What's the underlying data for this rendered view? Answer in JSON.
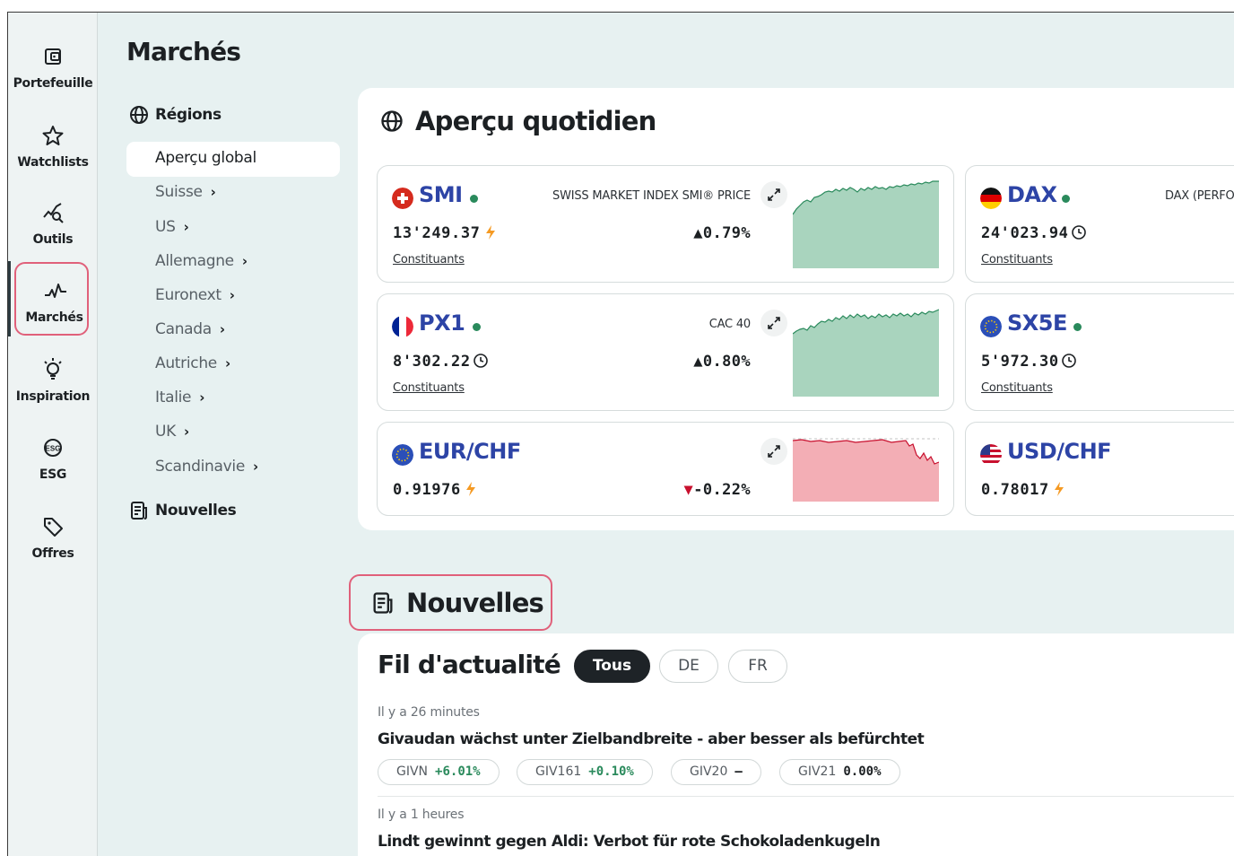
{
  "rail": [
    {
      "label": "Portefeuille",
      "icon": "wallet-icon"
    },
    {
      "label": "Watchlists",
      "icon": "star-icon"
    },
    {
      "label": "Outils",
      "icon": "chart-search-icon"
    },
    {
      "label": "Marchés",
      "icon": "pulse-icon",
      "active": true
    },
    {
      "label": "Inspiration",
      "icon": "lightbulb-icon"
    },
    {
      "label": "ESG",
      "icon": "esg-leaf-icon"
    },
    {
      "label": "Offres",
      "icon": "tag-icon"
    }
  ],
  "page_title": "Marchés",
  "nav": {
    "regions_label": "Régions",
    "items": [
      {
        "label": "Aperçu global",
        "selected": true,
        "chevron": ""
      },
      {
        "label": "Suisse",
        "chevron": "›"
      },
      {
        "label": "US",
        "chevron": "›"
      },
      {
        "label": "Allemagne",
        "chevron": "›"
      },
      {
        "label": "Euronext",
        "chevron": "›"
      },
      {
        "label": "Canada",
        "chevron": "›"
      },
      {
        "label": "Autriche",
        "chevron": "›"
      },
      {
        "label": "Italie",
        "chevron": "›"
      },
      {
        "label": "UK",
        "chevron": "›"
      },
      {
        "label": "Scandinavie",
        "chevron": "›"
      }
    ],
    "news_label": "Nouvelles"
  },
  "overview": {
    "title": "Aperçu quotidien",
    "constituents_label": "Constituants",
    "cards": [
      {
        "symbol": "SMI",
        "name": "SWISS MARKET INDEX SMI® PRICE",
        "price": "13'249.37",
        "price_icon": "bolt-icon",
        "change": "▲0.79%",
        "trend": "up",
        "constituents": true,
        "live": true,
        "flag": "ch"
      },
      {
        "symbol": "DAX",
        "name": "DAX (PERFORMANCE)",
        "price": "24'023.94",
        "price_icon": "clock-icon",
        "change": "",
        "trend": "up",
        "constituents": true,
        "live": true,
        "flag": "de"
      },
      {
        "symbol": "PX1",
        "name": "CAC 40",
        "price": "8'302.22",
        "price_icon": "clock-icon",
        "change": "▲0.80%",
        "trend": "up",
        "constituents": true,
        "live": true,
        "flag": "fr"
      },
      {
        "symbol": "SX5E",
        "name": "",
        "price": "5'972.30",
        "price_icon": "clock-icon",
        "change": "",
        "trend": "up",
        "constituents": true,
        "live": true,
        "flag": "eu"
      },
      {
        "symbol": "EUR/CHF",
        "name": "",
        "price": "0.91976",
        "price_icon": "bolt-icon",
        "change": "▼-0.22%",
        "trend": "down",
        "constituents": false,
        "live": false,
        "flag": "eu"
      },
      {
        "symbol": "USD/CHF",
        "name": "",
        "price": "0.78017",
        "price_icon": "bolt-icon",
        "change": "",
        "trend": "up",
        "constituents": false,
        "live": false,
        "flag": "us"
      }
    ]
  },
  "news": {
    "title": "Nouvelles",
    "feed_title": "Fil d'actualité",
    "filters": [
      "Tous",
      "DE",
      "FR"
    ],
    "active_filter": "Tous",
    "items": [
      {
        "time": "Il y a 26 minutes",
        "headline": "Givaudan wächst unter Zielbandbreite - aber besser als befürchtet",
        "tags": [
          {
            "symbol": "GIVN",
            "value": "+6.01%",
            "dir": "up"
          },
          {
            "symbol": "GIV161",
            "value": "+0.10%",
            "dir": "up"
          },
          {
            "symbol": "GIV20",
            "value": "—",
            "dir": "flat"
          },
          {
            "symbol": "GIV21",
            "value": "0.00%",
            "dir": "flat"
          }
        ]
      },
      {
        "time": "Il y a 1 heures",
        "headline": "Lindt gewinnt gegen Aldi: Verbot für rote Schokoladenkugeln",
        "tags": []
      }
    ]
  },
  "colors": {
    "accent_blue": "#2d44a6",
    "up": "#2a8a5c",
    "down": "#c8102e",
    "highlight": "#e0607a"
  }
}
